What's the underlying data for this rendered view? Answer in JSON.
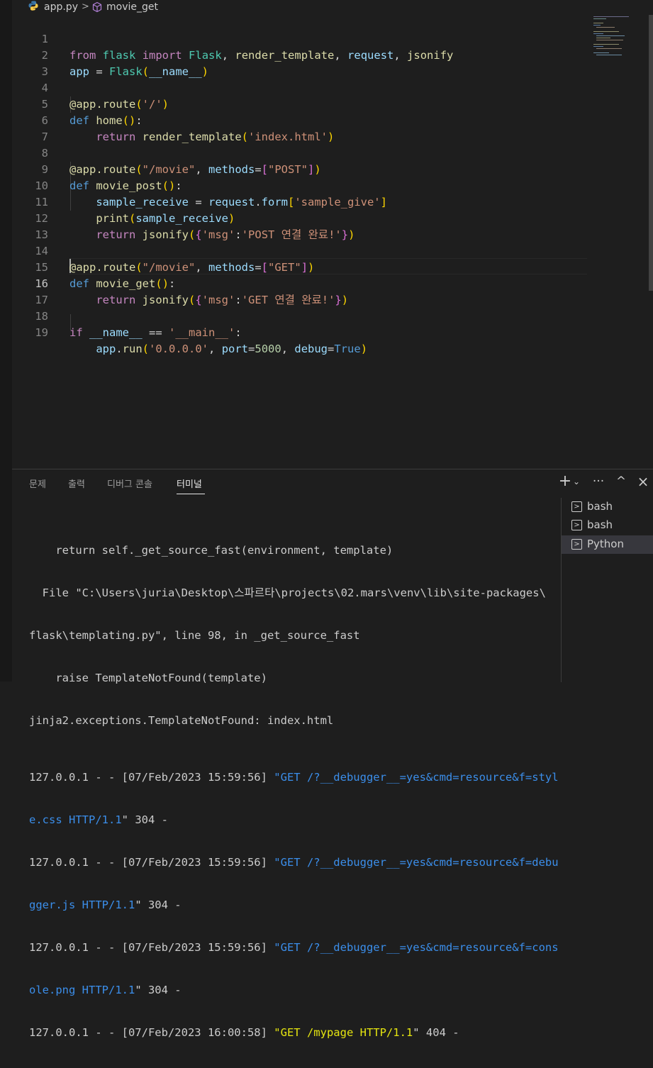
{
  "breadcrumb": {
    "file": "app.py",
    "separator": ">",
    "symbol": "movie_get",
    "file_icon": "python-icon",
    "symbol_icon": "method-cube-icon"
  },
  "editor": {
    "active_line": 16,
    "lines": [
      {
        "n": "1"
      },
      {
        "n": "2"
      },
      {
        "n": "3"
      },
      {
        "n": "4"
      },
      {
        "n": "5"
      },
      {
        "n": "6"
      },
      {
        "n": "7"
      },
      {
        "n": "8"
      },
      {
        "n": "9"
      },
      {
        "n": "10"
      },
      {
        "n": "11"
      },
      {
        "n": "12"
      },
      {
        "n": "13"
      },
      {
        "n": "14"
      },
      {
        "n": "15"
      },
      {
        "n": "16"
      },
      {
        "n": "17"
      },
      {
        "n": "18"
      },
      {
        "n": "19"
      }
    ],
    "tokens": {
      "from": "from",
      "flask": "flask",
      "import": "import",
      "Flask": "Flask",
      "comma1": ", ",
      "render_template": "render_template",
      "request": "request",
      "jsonify": "jsonify",
      "app": "app",
      "eq": " = ",
      "lp": "(",
      "rp": ")",
      "dunder_name": "__name__",
      "deco_app": "@app",
      "dot_route": ".route",
      "slash_str": "'/'",
      "def": "def",
      "home": "home",
      "colon": ":",
      "return": "return",
      "index_str": "'index.html'",
      "movie_str": "\"/movie\"",
      "methods": "methods",
      "eqs": "=",
      "lb": "[",
      "rb": "]",
      "post_str": "\"POST\"",
      "movie_post": "movie_post",
      "sample_receive": "sample_receive",
      "form": "form",
      "sample_give": "'sample_give'",
      "print": "print",
      "lc": "{",
      "rc": "}",
      "msg": "'msg'",
      "post_msg": "'POST 연결 완료!'",
      "get_str": "\"GET\"",
      "movie_get": "movie_get",
      "get_msg": "'GET 연결 완료!'",
      "if": "if",
      "eqeq": " == ",
      "main_str": "'__main__'",
      "run": "run",
      "host": "'0.0.0.0'",
      "port": "port",
      "port_val": "5000",
      "debug": "debug",
      "True": "True",
      "dot": "."
    }
  },
  "panel": {
    "tabs": [
      "문제",
      "출력",
      "디버그 콘솔",
      "터미널"
    ],
    "active_tab": "터미널",
    "actions": {
      "add": "+",
      "dropdown": "⌄",
      "more": "···",
      "maximize": "^",
      "close": "×"
    },
    "terminal_lines": [
      "    return self._get_source_fast(environment, template)",
      "  File \"C:\\Users\\juria\\Desktop\\스파르타\\projects\\02.mars\\venv\\lib\\site-packages\\",
      "flask\\templating.py\", line 98, in _get_source_fast",
      "    raise TemplateNotFound(template)",
      "jinja2.exceptions.TemplateNotFound: index.html"
    ],
    "log": [
      {
        "pre": "127.0.0.1 - - [07/Feb/2023 15:59:56] ",
        "q": "\"",
        "req1": "GET /?__debugger__=yes&cmd=resource&f=styl",
        "req2": "e.css HTTP/1.1",
        "post": "\" 304 -"
      },
      {
        "pre": "127.0.0.1 - - [07/Feb/2023 15:59:56] ",
        "q": "\"",
        "req1": "GET /?__debugger__=yes&cmd=resource&f=debu",
        "req2": "gger.js HTTP/1.1",
        "post": "\" 304 -"
      },
      {
        "pre": "127.0.0.1 - - [07/Feb/2023 15:59:56] ",
        "q": "\"",
        "req1": "GET /?__debugger__=yes&cmd=resource&f=cons",
        "req2": "ole.png HTTP/1.1",
        "post": "\" 304 -"
      },
      {
        "pre": "127.0.0.1 - - [07/Feb/2023 16:00:58] ",
        "q": "\"",
        "req1": "GET /mypage HTTP/1.1",
        "post": "\" 404 -"
      }
    ],
    "terminals": [
      {
        "label": "bash",
        "icon": "terminal-icon"
      },
      {
        "label": "bash",
        "icon": "terminal-icon"
      },
      {
        "label": "Python",
        "icon": "terminal-icon",
        "selected": true
      }
    ]
  },
  "colors": {
    "keyword": "#c586c0",
    "def": "#569cd6",
    "func": "#dcdcaa",
    "string": "#ce9178",
    "variable": "#9cdcfe",
    "number": "#b5cea8",
    "class": "#4ec9b0",
    "bg": "#1e1e1e",
    "log_blue": "#3b8eea",
    "log_yellow": "#e5e510"
  }
}
